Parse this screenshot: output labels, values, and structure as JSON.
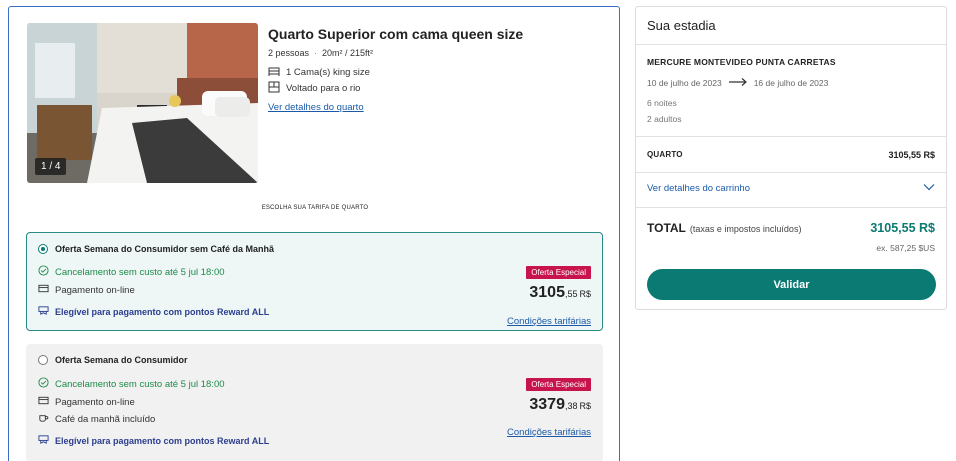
{
  "room": {
    "title": "Quarto Superior com cama queen size",
    "guests": "2 pessoas",
    "size": "20m² / 215ft²",
    "bed": "1 Cama(s) king size",
    "view": "Voltado para o rio",
    "details_link": "Ver detalhes do quarto",
    "photo_counter": "1 / 4"
  },
  "rates_heading": "ESCOLHA SUA TARIFA DE QUARTO",
  "rates": [
    {
      "title": "Oferta Semana do Consumidor sem Café da Manhã",
      "cancellation": "Cancelamento sem custo até 5 jul 18:00",
      "payment": "Pagamento on-line",
      "reward": "Elegível para pagamento com pontos Reward ALL",
      "badge": "Oferta Especial",
      "price_int": "3105",
      "price_dec": ",55",
      "currency": "R$",
      "conditions": "Condições tarifárias"
    },
    {
      "title": "Oferta Semana do Consumidor",
      "cancellation": "Cancelamento sem custo até 5 jul 18:00",
      "payment": "Pagamento on-line",
      "breakfast": "Café da manhã incluído",
      "reward": "Elegível para pagamento com pontos Reward ALL",
      "badge": "Oferta Especial",
      "price_int": "3379",
      "price_dec": ",38",
      "currency": "R$",
      "conditions": "Condições tarifárias"
    }
  ],
  "stay": {
    "heading": "Sua estadia",
    "hotel": "MERCURE MONTEVIDEO PUNTA CARRETAS",
    "check_in": "10 de julho de 2023",
    "check_out": "16 de julho de 2023",
    "nights": "6 noites",
    "adults": "2 adultos",
    "room_label": "QUARTO",
    "room_price": "3105,55 R$",
    "cart_link": "Ver detalhes do carrinho",
    "total_label": "TOTAL",
    "total_sub": "(taxas e impostos incluídos)",
    "total_price": "3105,55 R$",
    "total_usd": "ex. 587,25 $US",
    "validate_label": "Validar"
  },
  "colors": {
    "accent": "#0b7a73",
    "badge": "#c8144d",
    "link": "#1a5aa8",
    "card_border": "#3a6fc4"
  }
}
